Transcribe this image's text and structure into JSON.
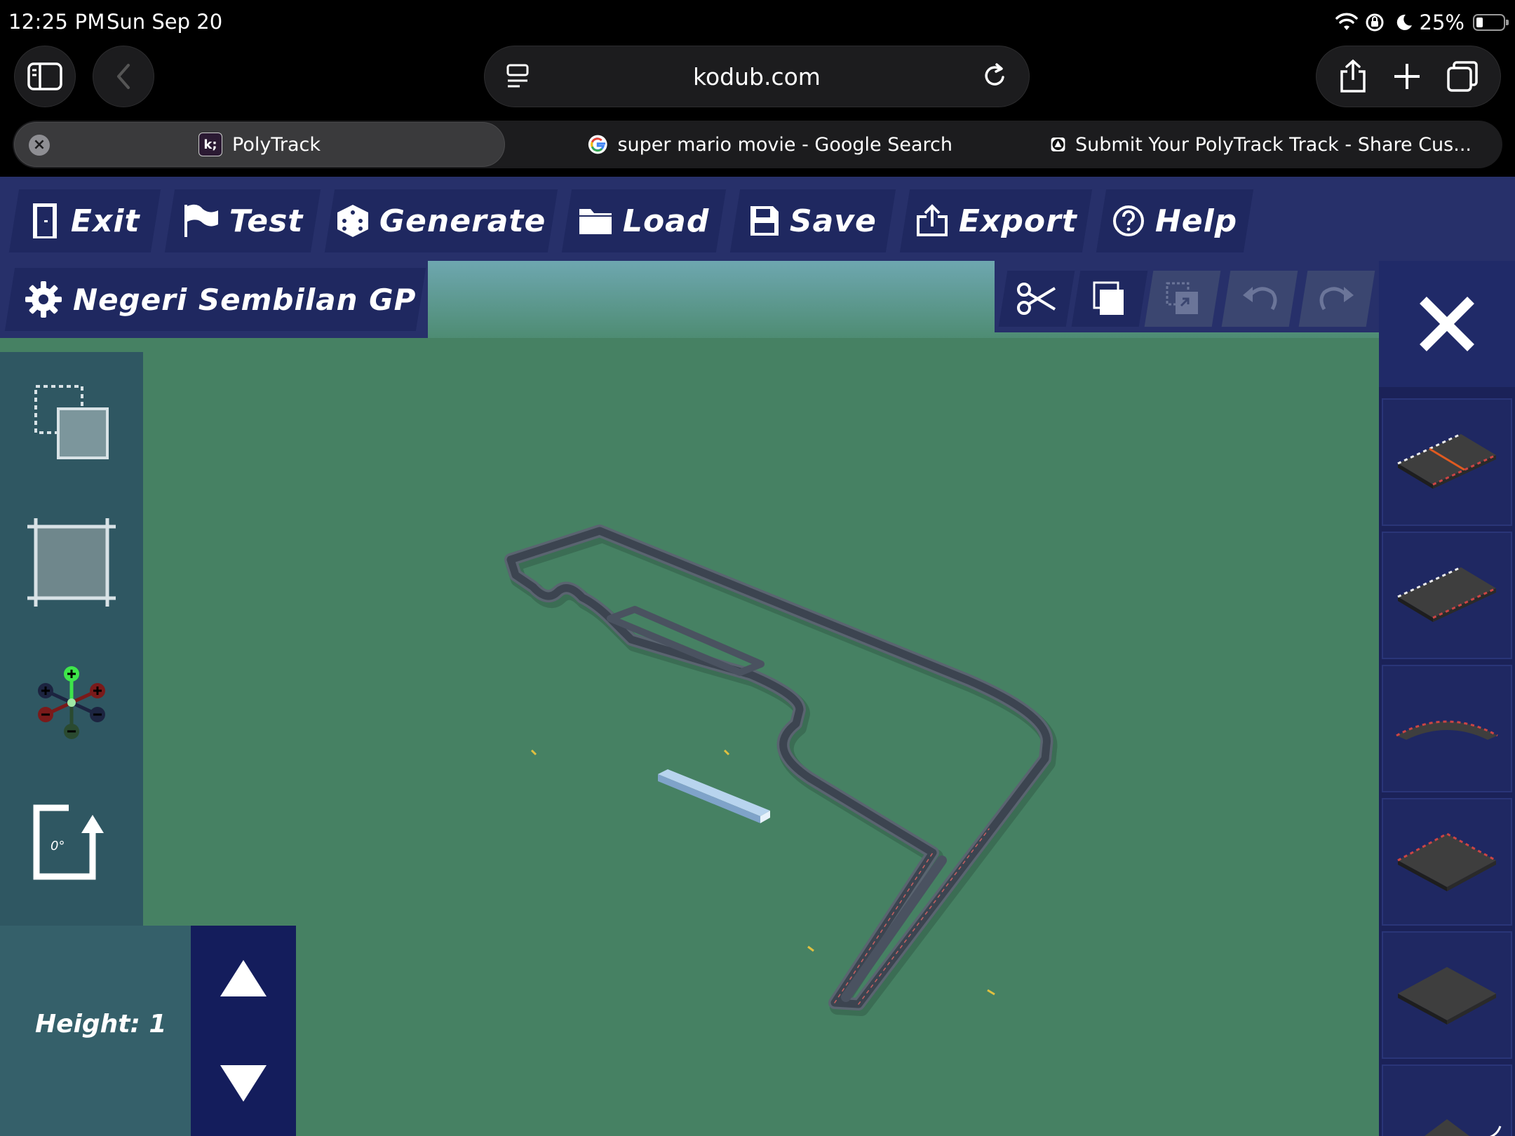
{
  "status": {
    "time": "12:25 PM",
    "date": "Sun Sep 20",
    "battery": "25%"
  },
  "browser": {
    "url": "kodub.com",
    "tabs": [
      {
        "title": "PolyTrack",
        "favicon": "kodub-icon",
        "active": true
      },
      {
        "title": "super mario movie - Google Search",
        "favicon": "google-icon",
        "active": false
      },
      {
        "title": "Submit Your PolyTrack Track - Share Cus...",
        "favicon": "polytrack-icon",
        "active": false
      }
    ]
  },
  "game": {
    "menu": {
      "exit": "Exit",
      "test": "Test",
      "generate": "Generate",
      "load": "Load",
      "save": "Save",
      "export": "Export",
      "help": "Help"
    },
    "track_name": "Negeri Sembilan GP",
    "rotation": "0°",
    "height_label": "Height: 1",
    "edit_tools": [
      "scissors-icon",
      "copy-icon",
      "paste-icon",
      "undo-icon",
      "redo-icon"
    ],
    "pieces": [
      "start-line-piece",
      "straight-piece",
      "curve-piece",
      "corner-piece",
      "flat-block-piece",
      "ramp-piece"
    ],
    "colors": {
      "ground": "#468163",
      "menu_bg": "#27306a",
      "button_bg": "#1f2860",
      "panel": "#2f5762"
    }
  }
}
